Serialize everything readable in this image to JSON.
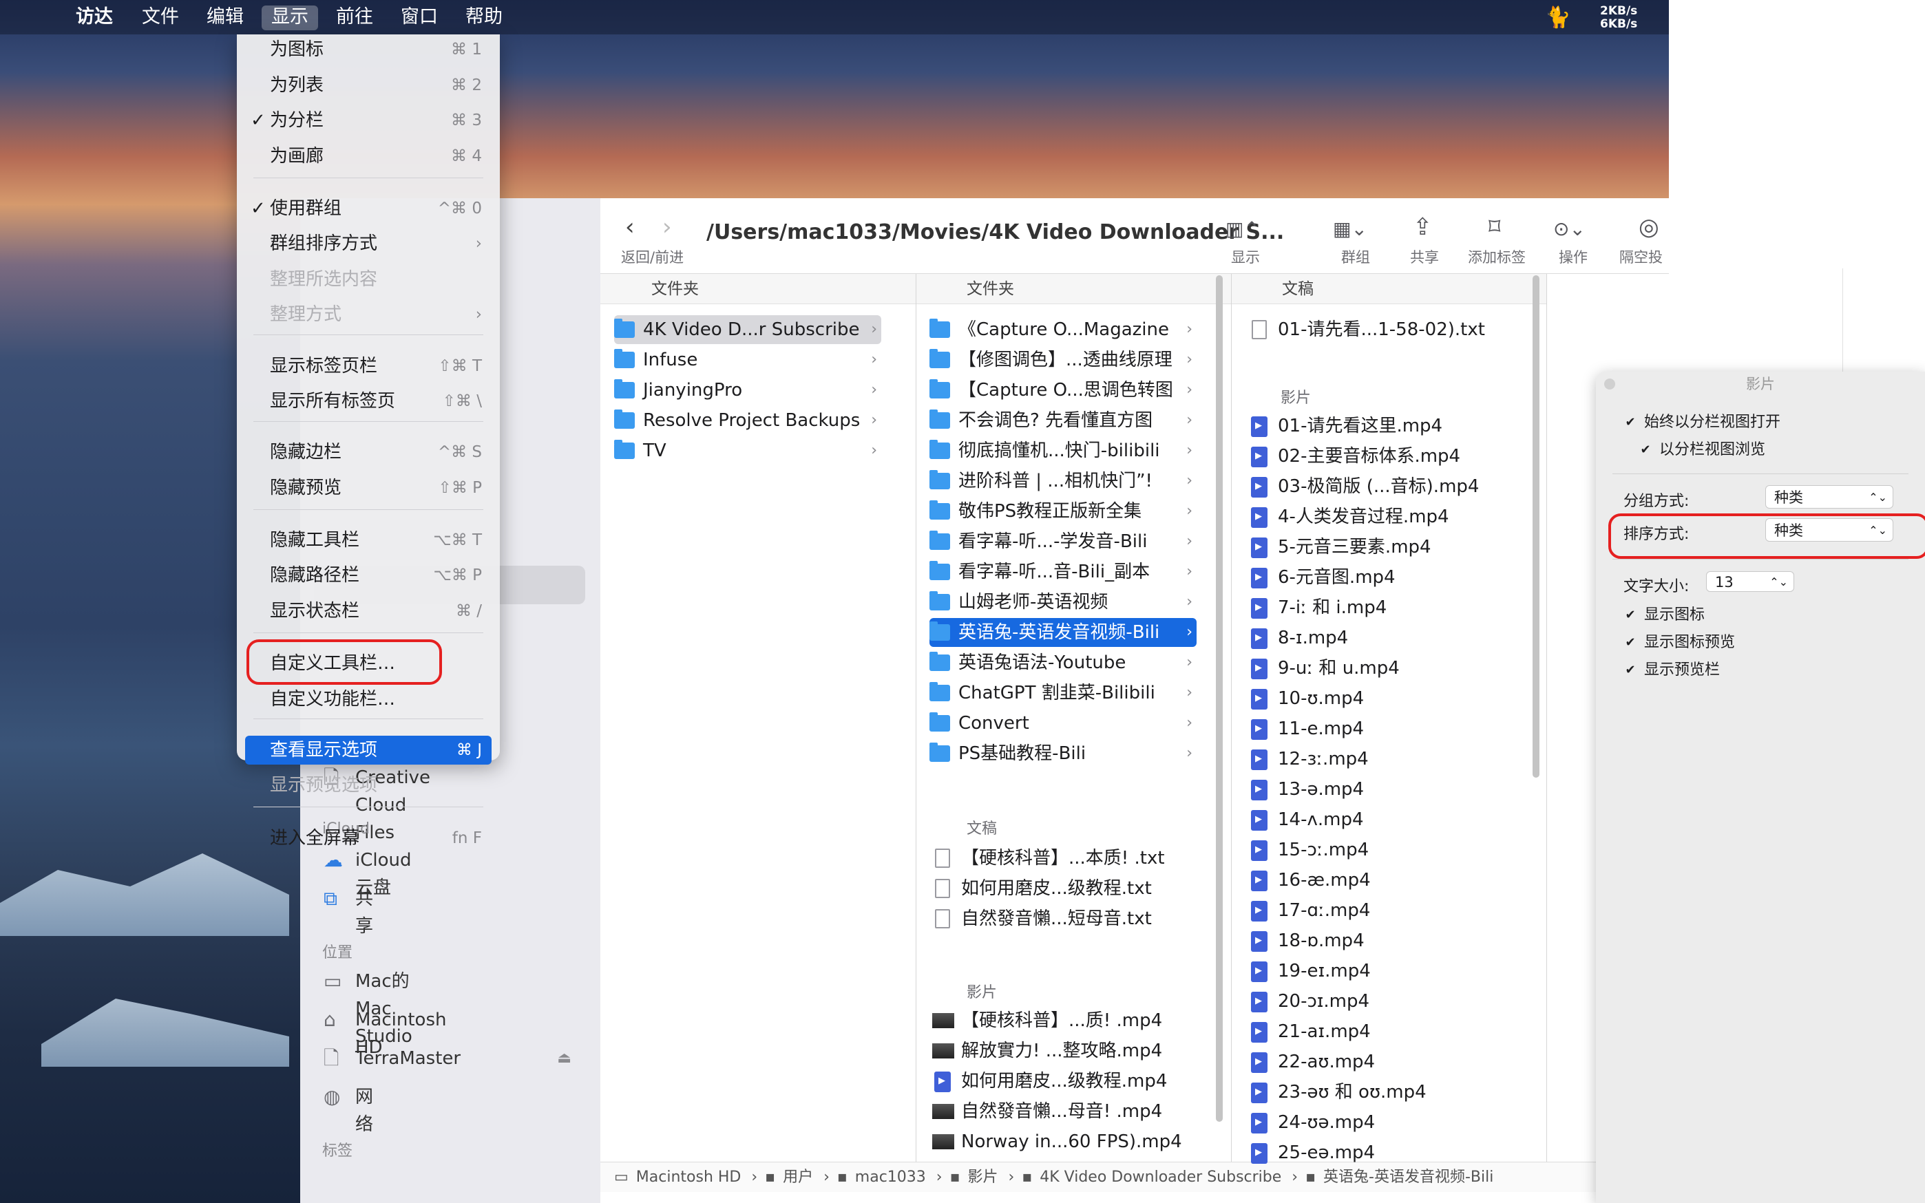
{
  "menubar": {
    "apple": "",
    "items": [
      "访达",
      "文件",
      "编辑",
      "显示",
      "前往",
      "窗口",
      "帮助"
    ],
    "net_up": "2KB/s",
    "net_down": "6KB/s"
  },
  "menu": {
    "items": [
      {
        "label": "为图标",
        "shortcut": "⌘ 1",
        "checked": false,
        "disabled": false
      },
      {
        "label": "为列表",
        "shortcut": "⌘ 2",
        "checked": false,
        "disabled": false
      },
      {
        "label": "为分栏",
        "shortcut": "⌘ 3",
        "checked": true,
        "disabled": false
      },
      {
        "label": "为画廊",
        "shortcut": "⌘ 4",
        "checked": false,
        "disabled": false
      },
      {
        "label": "使用群组",
        "shortcut": "^⌘ 0",
        "checked": true,
        "disabled": false
      },
      {
        "label": "群组排序方式",
        "shortcut": "›",
        "checked": false,
        "disabled": false
      },
      {
        "label": "整理所选内容",
        "shortcut": "",
        "checked": false,
        "disabled": true
      },
      {
        "label": "整理方式",
        "shortcut": "›",
        "checked": false,
        "disabled": true
      },
      {
        "label": "显示标签页栏",
        "shortcut": "⇧⌘ T",
        "checked": false,
        "disabled": false
      },
      {
        "label": "显示所有标签页",
        "shortcut": "⇧⌘ \\",
        "checked": false,
        "disabled": false
      },
      {
        "label": "隐藏边栏",
        "shortcut": "^⌘ S",
        "checked": false,
        "disabled": false
      },
      {
        "label": "隐藏预览",
        "shortcut": "⇧⌘ P",
        "checked": false,
        "disabled": false
      },
      {
        "label": "隐藏工具栏",
        "shortcut": "⌥⌘ T",
        "checked": false,
        "disabled": false
      },
      {
        "label": "隐藏路径栏",
        "shortcut": "⌥⌘ P",
        "checked": false,
        "disabled": false
      },
      {
        "label": "显示状态栏",
        "shortcut": "⌘ /",
        "checked": false,
        "disabled": false
      },
      {
        "label": "自定义工具栏…",
        "shortcut": "",
        "checked": false,
        "disabled": false
      },
      {
        "label": "自定义功能栏…",
        "shortcut": "",
        "checked": false,
        "disabled": false
      },
      {
        "label": "查看显示选项",
        "shortcut": "⌘ J",
        "checked": false,
        "disabled": false
      },
      {
        "label": "显示预览选项",
        "shortcut": "",
        "checked": false,
        "disabled": true
      },
      {
        "label": "进入全屏幕",
        "shortcut": "fn F",
        "checked": false,
        "disabled": false
      }
    ]
  },
  "toolbar": {
    "back_forward": "返回/前进",
    "path": "/Users/mac1033/Movies/4K Video Downloader S...",
    "display": "显示",
    "group": "群组",
    "share": "共享",
    "add_tag": "添加标签",
    "action": "操作",
    "airdrop": "隔空投"
  },
  "sidebar": {
    "cc_files": "Creative Cloud Files",
    "icloud_header": "iCloud",
    "icloud_drive": "iCloud云盘",
    "shared": "共享",
    "locations_header": "位置",
    "mac_studio": "Mac的Mac Studio",
    "macintosh_hd": "Macintosh HD",
    "terramaster": "TerraMaster",
    "network": "网络",
    "tags_header": "标签"
  },
  "col1": {
    "header": "文件夹",
    "items": [
      "4K Video D...r Subscribe",
      "Infuse",
      "JianyingPro",
      "Resolve Project Backups",
      "TV"
    ]
  },
  "col2": {
    "header": "文件夹",
    "folders": [
      "《Capture O...Magazine",
      "【修图调色】...透曲线原理",
      "【Capture O...思调色转图",
      "不会调色? 先看懂直方图",
      "彻底搞懂机...快门-bilibili",
      "进阶科普 | ...相机快门”!",
      "敬伟PS教程正版新全集",
      "看字幕-听...-学发音-Bili",
      "看字幕-听...音-Bili_副本",
      "山姆老师-英语视频",
      "英语兔-英语发音视频-Bili",
      "英语兔语法-Youtube",
      "ChatGPT 割韭菜-Bilibili",
      "Convert",
      "PS基础教程-Bili"
    ],
    "docs_header": "文稿",
    "docs": [
      "【硬核科普】...本质! .txt",
      "如何用磨皮...级教程.txt",
      "自然發音懶...短母音.txt"
    ],
    "movies_header": "影片",
    "movies": [
      "【硬核科普】...质! .mp4",
      "解放實力! ...整攻略.mp4",
      "如何用磨皮...级教程.mp4",
      "自然發音懶...母音! .mp4",
      "Norway in...60 FPS).mp4"
    ]
  },
  "col3": {
    "header": "文稿",
    "docs": [
      "01-请先看...1-58-02).txt"
    ],
    "movies_header": "影片",
    "movies": [
      "01-请先看这里.mp4",
      "02-主要音标体系.mp4",
      "03-极简版 (...音标).mp4",
      "4-人类发音过程.mp4",
      "5-元音三要素.mp4",
      "6-元音图.mp4",
      "7-iː 和 i.mp4",
      "8-ɪ.mp4",
      "9-uː 和 u.mp4",
      "10-ʊ.mp4",
      "11-e.mp4",
      "12-ɜː.mp4",
      "13-ə.mp4",
      "14-ʌ.mp4",
      "15-ɔː.mp4",
      "16-æ.mp4",
      "17-ɑː.mp4",
      "18-ɒ.mp4",
      "19-eɪ.mp4",
      "20-ɔɪ.mp4",
      "21-aɪ.mp4",
      "22-aʊ.mp4",
      "23-əʊ 和 oʊ.mp4",
      "24-ʊə.mp4",
      "25-eə.mp4"
    ]
  },
  "pathbar": [
    "Macintosh HD",
    "用户",
    "mac1033",
    "影片",
    "4K Video Downloader Subscribe",
    "英语兔-英语发音视频-Bili"
  ],
  "view_options": {
    "title": "影片",
    "always_column": "始终以分栏视图打开",
    "browse_column": "以分栏视图浏览",
    "group_by_label": "分组方式:",
    "group_by_value": "种类",
    "sort_by_label": "排序方式:",
    "sort_by_value": "种类",
    "text_size_label": "文字大小:",
    "text_size_value": "13",
    "show_icons": "显示图标",
    "show_icon_preview": "显示图标预览",
    "show_preview_column": "显示预览栏"
  }
}
